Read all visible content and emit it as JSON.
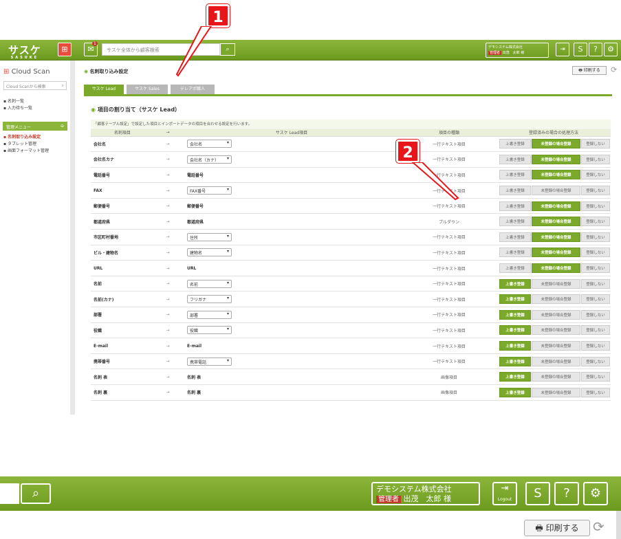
{
  "header": {
    "logo": "サスケ",
    "logo_sub": "SASUKE",
    "notification_count": "1",
    "search_placeholder": "サスケ全体から顧客検索",
    "company": "デモシステム株式会社",
    "role_badge": "管理者",
    "user": "出茂　太郎 様",
    "logout": "Logout"
  },
  "sidebar": {
    "title": "Cloud Scan",
    "search_placeholder": "Cloud Scanから検索",
    "links": [
      "名刺一覧",
      "入力待ち一覧"
    ],
    "menu_title": "管理メニュー",
    "sub_items": [
      "名刺取り込み設定",
      "タブレット管理",
      "画面フォーマット管理"
    ]
  },
  "page": {
    "title": "名刺取り込み設定",
    "print_label": "印刷する",
    "tabs": [
      "サスケ Lead",
      "サスケ Sales",
      "テレアポ職人"
    ],
    "section_title": "項目の割り当て（サスケ Lead）",
    "description": "「顧客テーブル設定」で設定した項目とインポートデータの項目を合わせる設定を行います。"
  },
  "table": {
    "headers": [
      "名刺項目",
      "→",
      "サスケ Lead項目",
      "項目の種類",
      "登録済みの場合の処理方法"
    ],
    "arrow": "→",
    "button_labels": [
      "上書き登録",
      "未登録の場合登録",
      "登録しない"
    ],
    "rows": [
      {
        "field": "会社名",
        "map": "会社名",
        "select": true,
        "type": "一行テキスト項目",
        "active": 1
      },
      {
        "field": "会社名カナ",
        "map": "会社名（カナ）",
        "select": true,
        "type": "一行テキスト項目",
        "active": 1
      },
      {
        "field": "電話番号",
        "map": "電話番号",
        "select": false,
        "type": "一行テキスト項目",
        "active": 1
      },
      {
        "field": "FAX",
        "map": "FAX番号",
        "select": true,
        "type": "一行テキスト項目",
        "active": -1
      },
      {
        "field": "郵便番号",
        "map": "郵便番号",
        "select": false,
        "type": "一行テキスト項目",
        "active": 1
      },
      {
        "field": "都道府県",
        "map": "都道府県",
        "select": false,
        "type": "プルダウン",
        "active": 1
      },
      {
        "field": "市区町村番地",
        "map": "住所",
        "select": true,
        "type": "一行テキスト項目",
        "active": 1
      },
      {
        "field": "ビル・建物名",
        "map": "建物名",
        "select": true,
        "type": "一行テキスト項目",
        "active": 1
      },
      {
        "field": "URL",
        "map": "URL",
        "select": false,
        "type": "一行テキスト項目",
        "active": 1
      },
      {
        "field": "名前",
        "map": "名前",
        "select": true,
        "type": "一行テキスト項目",
        "active": 0
      },
      {
        "field": "名前(カナ)",
        "map": "フリガナ",
        "select": true,
        "type": "一行テキスト項目",
        "active": 0
      },
      {
        "field": "部署",
        "map": "部署",
        "select": true,
        "type": "一行テキスト項目",
        "active": 0
      },
      {
        "field": "役職",
        "map": "役職",
        "select": true,
        "type": "一行テキスト項目",
        "active": 0
      },
      {
        "field": "E-mail",
        "map": "E-mail",
        "select": false,
        "type": "一行テキスト項目",
        "active": 0
      },
      {
        "field": "携帯番号",
        "map": "携帯電話",
        "select": true,
        "type": "一行テキスト項目",
        "active": 0
      },
      {
        "field": "名刺 表",
        "map": "名刺 表",
        "select": false,
        "type": "画像項目",
        "active": 0
      },
      {
        "field": "名刺 裏",
        "map": "名刺 裏",
        "select": false,
        "type": "画像項目",
        "active": 0
      }
    ]
  },
  "callouts": [
    "1",
    "2"
  ],
  "colors": {
    "accent": "#7aa92c",
    "callout": "#e8161b",
    "badge": "#c0392b"
  }
}
